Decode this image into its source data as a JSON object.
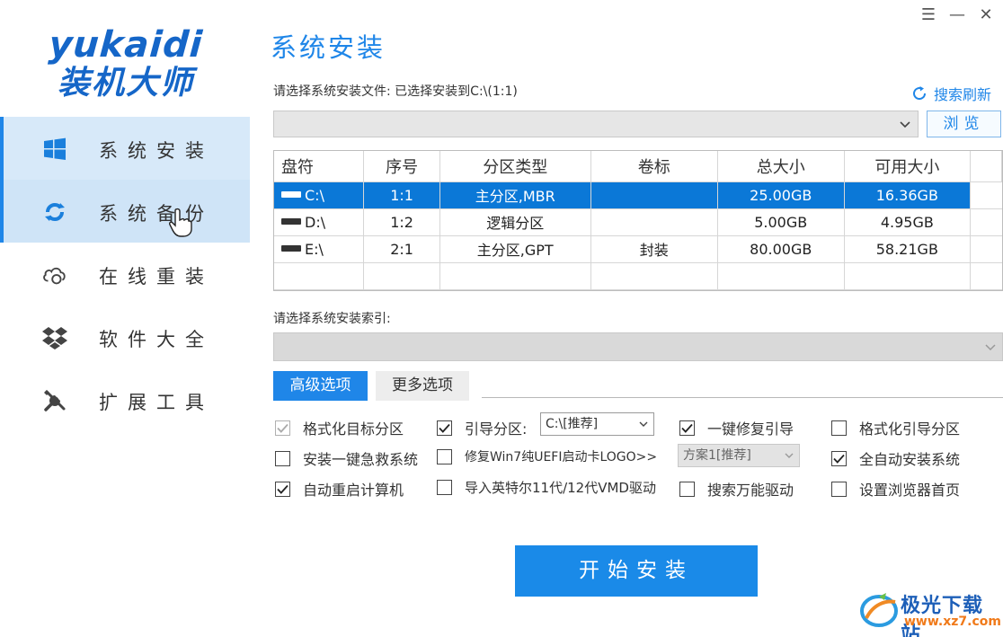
{
  "logo": {
    "en": "yukaidi",
    "cn": "装机大师"
  },
  "sidebar": {
    "items": [
      {
        "label": "系统安装",
        "icon": "windows-icon"
      },
      {
        "label": "系统备份",
        "icon": "backup-icon"
      },
      {
        "label": "在线重装",
        "icon": "cloud-icon"
      },
      {
        "label": "软件大全",
        "icon": "dropbox-icon"
      },
      {
        "label": "扩展工具",
        "icon": "tools-icon"
      }
    ]
  },
  "window_controls": {
    "menu": "☰",
    "minimize": "—",
    "close": "✕"
  },
  "main": {
    "title": "系统安装",
    "file_label": "请选择系统安装文件: 已选择安装到C:\\(1:1)",
    "refresh_label": "搜索刷新",
    "file_value": "",
    "browse_label": "浏览",
    "table": {
      "headers": [
        "盘符",
        "序号",
        "分区类型",
        "卷标",
        "总大小",
        "可用大小"
      ],
      "rows": [
        {
          "drive": "C:\\",
          "index": "1:1",
          "type": "主分区,MBR",
          "label": "",
          "total": "25.00GB",
          "free": "16.36GB",
          "selected": true
        },
        {
          "drive": "D:\\",
          "index": "1:2",
          "type": "逻辑分区",
          "label": "",
          "total": "5.00GB",
          "free": "4.95GB",
          "selected": false
        },
        {
          "drive": "E:\\",
          "index": "2:1",
          "type": "主分区,GPT",
          "label": "封装",
          "total": "80.00GB",
          "free": "58.21GB",
          "selected": false
        }
      ]
    },
    "index_label": "请选择系统安装索引:",
    "index_value": ""
  },
  "tabs": {
    "advanced": "高级选项",
    "more": "更多选项"
  },
  "options": {
    "format_target": {
      "label": "格式化目标分区",
      "checked": true,
      "disabled": true
    },
    "boot_partition": {
      "label": "引导分区:",
      "checked": true,
      "value": "C:\\[推荐]"
    },
    "one_click_repair": {
      "label": "一键修复引导",
      "checked": true
    },
    "format_boot": {
      "label": "格式化引导分区",
      "checked": false
    },
    "rescue_system": {
      "label": "安装一键急救系统",
      "checked": false
    },
    "win7_uefi": {
      "label": "修复Win7纯UEFI启动卡LOGO>>",
      "checked": false,
      "value": "方案1[推荐]"
    },
    "auto_install": {
      "label": "全自动安装系统",
      "checked": true
    },
    "auto_restart": {
      "label": "自动重启计算机",
      "checked": true
    },
    "intel_vmd": {
      "label": "导入英特尔11代/12代VMD驱动",
      "checked": false
    },
    "search_driver": {
      "label": "搜索万能驱动",
      "checked": false
    },
    "browser_home": {
      "label": "设置浏览器首页",
      "checked": false
    }
  },
  "start_label": "开始安装",
  "watermark": {
    "title": "极光下载站",
    "url": "www.xz7.com"
  },
  "colors": {
    "accent": "#1f86e8",
    "selected_row": "#0b78d7",
    "brand": "#1566c8"
  }
}
